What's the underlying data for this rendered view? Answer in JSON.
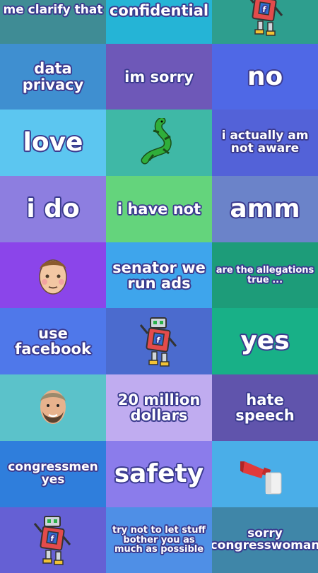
{
  "tiles": [
    {
      "text": "me clarify that",
      "bg": "#3f8c95",
      "size": "t-sm"
    },
    {
      "text": "confidential",
      "bg": "#25b4d6",
      "size": "t-md"
    },
    {
      "icon": "robot-icon",
      "bg": "#2e9e8e"
    },
    {
      "text": "data privacy",
      "bg": "#3f8fd0",
      "size": "t-md"
    },
    {
      "text": "im sorry",
      "bg": "#6e58b8",
      "size": "t-md"
    },
    {
      "text": "no",
      "bg": "#4f68e6",
      "size": "t-xl"
    },
    {
      "text": "love",
      "bg": "#5cc6f0",
      "size": "t-xl"
    },
    {
      "icon": "lizard-icon",
      "bg": "#3fb8a6"
    },
    {
      "text": "i actually am not aware",
      "bg": "#5362d8",
      "size": "t-sm"
    },
    {
      "text": "i do",
      "bg": "#8d7ee0",
      "size": "t-xl"
    },
    {
      "text": "i have not",
      "bg": "#64d47c",
      "size": "t-md"
    },
    {
      "text": "amm",
      "bg": "#6b83c9",
      "size": "t-xl"
    },
    {
      "icon": "face-icon",
      "bg": "#8b45ea"
    },
    {
      "text": "senator we run ads",
      "bg": "#3ea5ec",
      "size": "t-md"
    },
    {
      "text": "are the allegations true ...",
      "bg": "#1d9c79",
      "size": "t-xs"
    },
    {
      "text": "use facebook",
      "bg": "#4f78ea",
      "size": "t-md"
    },
    {
      "icon": "robot-icon",
      "bg": "#4b6bce"
    },
    {
      "text": "yes",
      "bg": "#18b087",
      "size": "t-xl"
    },
    {
      "icon": "man-face-icon",
      "bg": "#5bc2ca"
    },
    {
      "text": "20 million dollars",
      "bg": "#c0acf0",
      "size": "t-md"
    },
    {
      "text": "hate speech",
      "bg": "#6054ac",
      "size": "t-md"
    },
    {
      "text": "congressmen yes",
      "bg": "#2f7edc",
      "size": "t-sm"
    },
    {
      "text": "safety",
      "bg": "#8b7ceb",
      "size": "t-xl"
    },
    {
      "icon": "horn-icon",
      "bg": "#4aaee8"
    },
    {
      "icon": "robot-icon",
      "bg": "#6560d4"
    },
    {
      "text": "try not to let stuff bother you as much as possible",
      "bg": "#4f8fe6",
      "size": "t-xs"
    },
    {
      "text": "sorry congresswoman",
      "bg": "#3f86a8",
      "size": "t-sm"
    }
  ]
}
